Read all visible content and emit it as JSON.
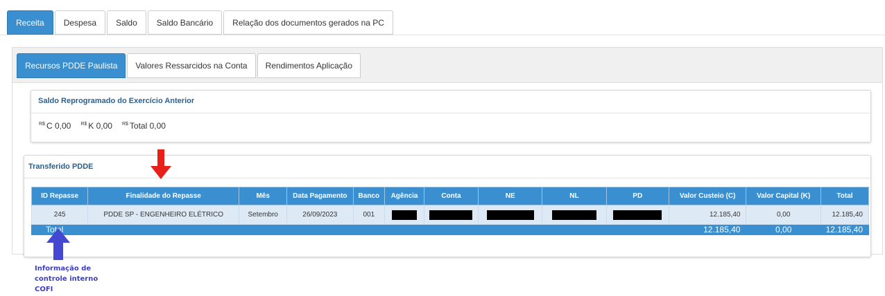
{
  "top_tabs": [
    "Receita",
    "Despesa",
    "Saldo",
    "Saldo Bancário",
    "Relação dos documentos gerados na PC"
  ],
  "sub_tabs": [
    "Recursos PDDE Paulista",
    "Valores Ressarcidos na Conta",
    "Rendimentos Aplicação"
  ],
  "saldo": {
    "title": "Saldo Reprogramado do Exercício Anterior",
    "currency": "R$",
    "c": "C 0,00",
    "k": "K 0,00",
    "total": "Total 0,00"
  },
  "transferido": {
    "title": "Transferido PDDE",
    "headers": [
      "ID Repasse",
      "Finalidade do Repasse",
      "Mês",
      "Data Pagamento",
      "Banco",
      "Agência",
      "Conta",
      "NE",
      "NL",
      "PD",
      "Valor Custeio (C)",
      "Valor Capital (K)",
      "Total"
    ],
    "row": {
      "id": "245",
      "finalidade": "PDDE SP - ENGENHEIRO ELÉTRICO",
      "mes": "Setembro",
      "data": "26/09/2023",
      "banco": "001",
      "custeio": "12.185,40",
      "capital": "0,00",
      "total": "12.185,40"
    },
    "totals": {
      "label": "Total",
      "custeio": "12.185,40",
      "capital": "0,00",
      "total": "12.185,40"
    }
  },
  "annotation": {
    "line1": "Informação de",
    "line2": "controle interno",
    "line3": "COFI"
  },
  "colors": {
    "active_tab": "#3a8fd0",
    "red_arrow": "#e8201c",
    "blue_arrow": "#4347d1"
  }
}
